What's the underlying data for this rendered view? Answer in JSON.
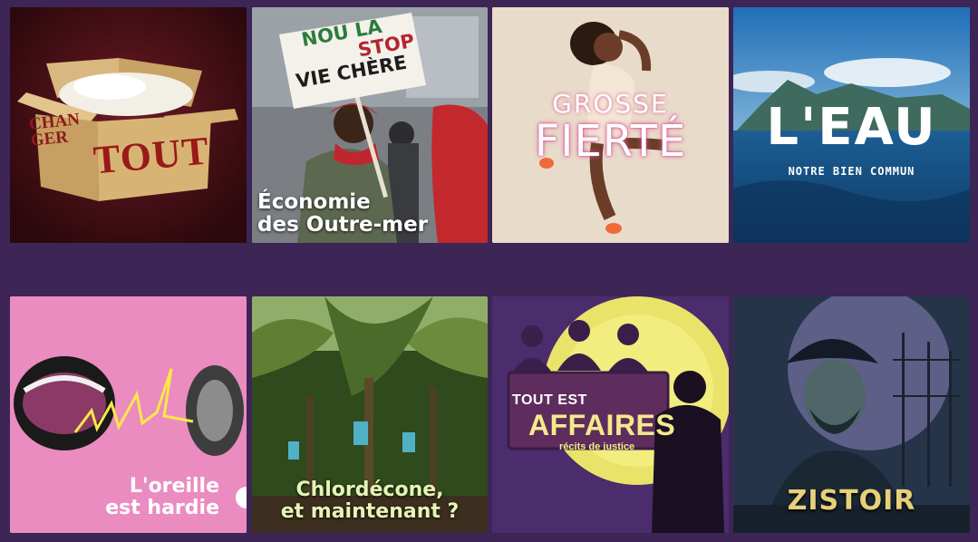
{
  "tiles": [
    {
      "id": "changer-tout",
      "lines": [
        "CHAN",
        "GER"
      ],
      "title": "TOUT"
    },
    {
      "id": "economie-outre-mer",
      "sign": [
        "NOU LA",
        "STOP",
        "VIE CHÈRE"
      ],
      "caption": [
        "Économie",
        "des Outre-mer"
      ]
    },
    {
      "id": "grosse-fierte",
      "title_line1": "GROSSE",
      "title_line2": "FIERTÉ"
    },
    {
      "id": "leau",
      "title": "L'EAU",
      "subtitle": "NOTRE BIEN COMMUN"
    },
    {
      "id": "oreille-hardie",
      "caption": [
        "L'oreille",
        "est hardie"
      ]
    },
    {
      "id": "chlordecone",
      "caption": [
        "Chlordécone,",
        "et maintenant ?"
      ]
    },
    {
      "id": "tout-est-affaires",
      "line1": "TOUT EST",
      "line2": "AFFAIRES",
      "line3": "récits de justice"
    },
    {
      "id": "zistoir",
      "title": "ZISTOIR"
    }
  ],
  "colors": {
    "background": "#3d2556",
    "accent_pink": "#ea8cc0",
    "gold": "#e7d07a"
  }
}
